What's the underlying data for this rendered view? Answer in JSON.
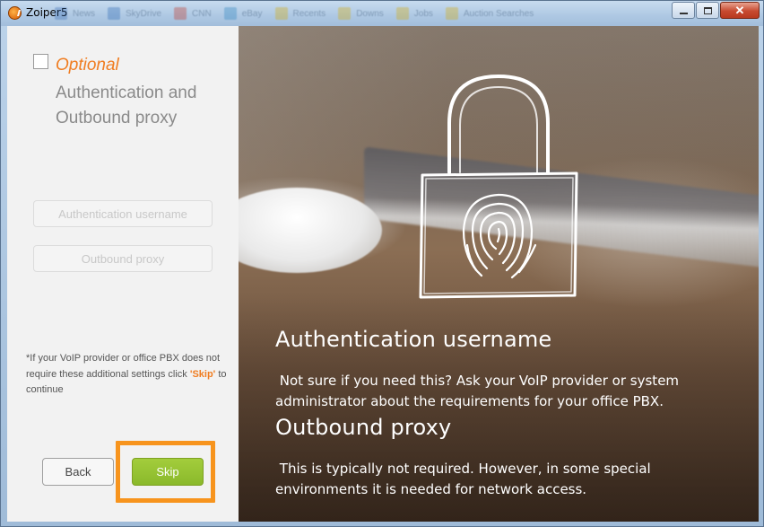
{
  "window": {
    "title": "Zoiper5",
    "controls": {
      "minimize": "",
      "maximize": "",
      "close": "✕"
    }
  },
  "taskbar_ghost": [
    "News",
    "SkyDrive",
    "CNN",
    "eBay",
    "Recents",
    "Downs",
    "Jobs",
    "Auction Searches"
  ],
  "left": {
    "optional_label": "Optional",
    "step_title": "Authentication and Outbound proxy",
    "fields": {
      "auth_username_placeholder": "Authentication username",
      "outbound_proxy_placeholder": "Outbound proxy"
    },
    "note": {
      "line1": "*If your VoIP provider or office PBX does not require these additional settings click ",
      "skip": "'Skip'",
      "line2": " to continue"
    },
    "buttons": {
      "back": "Back",
      "skip": "Skip"
    }
  },
  "right": {
    "icon": "fingerprint-padlock-icon",
    "sections": [
      {
        "heading": "Authentication username",
        "text": " Not sure if you need this? Ask your VoIP provider or system administrator about the requirements for your office PBX."
      },
      {
        "heading": "Outbound proxy",
        "text": " This is typically not required. However, in some special environments it is needed for network access."
      }
    ]
  },
  "colors": {
    "accent_orange": "#f07d21",
    "skip_green": "#8ab92b",
    "highlight_border": "#f7941d"
  }
}
